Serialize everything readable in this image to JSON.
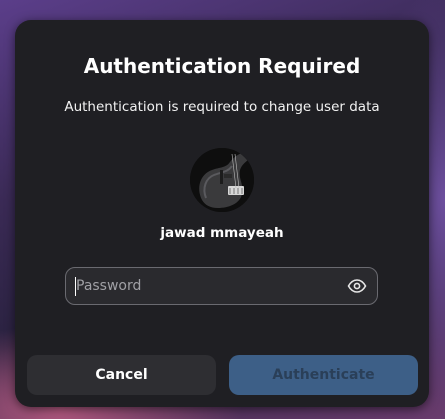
{
  "dialog": {
    "title": "Authentication Required",
    "description": "Authentication is required to change user data",
    "user": {
      "name": "jawad mmayeah",
      "avatar_icon": "bass-guitar-avatar"
    },
    "password": {
      "placeholder": "Password",
      "value": "",
      "reveal_icon": "eye-icon"
    },
    "buttons": {
      "cancel_label": "Cancel",
      "authenticate_label": "Authenticate"
    }
  },
  "colors": {
    "dialog_bg": "#1f1f23",
    "accent": "#3d5f87",
    "cancel_bg": "#2e2e32"
  }
}
